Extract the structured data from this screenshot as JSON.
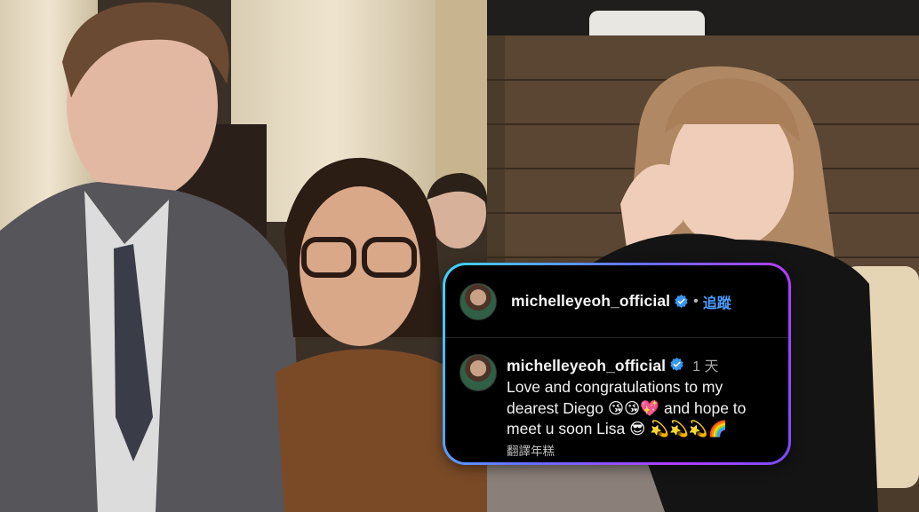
{
  "post": {
    "handle": "michelleyeoh_official",
    "follow_label": "追蹤",
    "dot": "•",
    "verified_icon": "verified-badge-icon"
  },
  "comment": {
    "handle": "michelleyeoh_official",
    "time": "1 天",
    "text": "Love and congratulations to my dearest Diego 😘😘💖 and hope to meet u soon Lisa 😎 💫💫💫🌈",
    "translate_label": "翻譯年糕"
  },
  "colors": {
    "card_background": "#000000",
    "border_gradient_start": "#3fd7ff",
    "border_gradient_end": "#b23dff",
    "follow_link": "#4b9bff"
  }
}
